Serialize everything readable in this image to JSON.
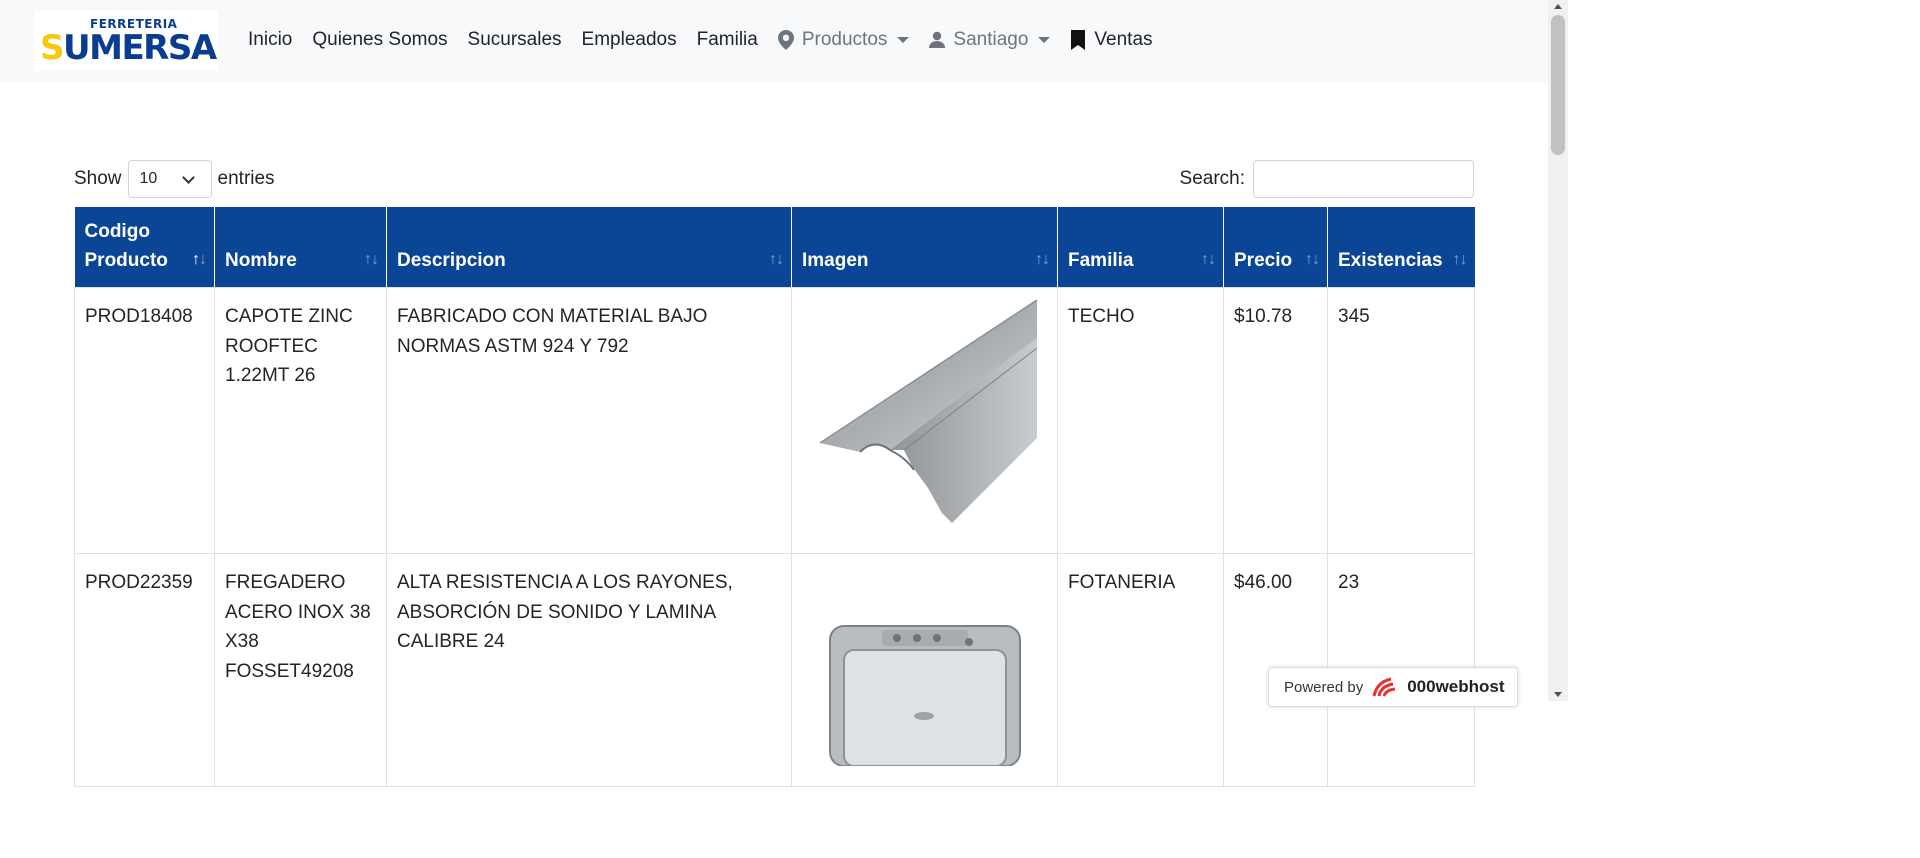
{
  "navbar": {
    "logo_top": "FERRETERIA",
    "logo_main": "SUMERSA",
    "items": [
      {
        "label": "Inicio"
      },
      {
        "label": "Quienes Somos"
      },
      {
        "label": "Sucursales"
      },
      {
        "label": "Empleados"
      },
      {
        "label": "Familia"
      },
      {
        "label": "Productos",
        "icon": "map-marker-icon"
      },
      {
        "label": "Santiago",
        "icon": "user-icon"
      },
      {
        "label": "Ventas",
        "icon": "bookmark-icon"
      }
    ]
  },
  "controls": {
    "show_label": "Show",
    "page_size": "10",
    "entries_label": "entries",
    "search_label": "Search:",
    "search_value": ""
  },
  "table": {
    "columns": [
      "Codigo Producto",
      "Nombre",
      "Descripcion",
      "Imagen",
      "Familia",
      "Precio",
      "Existencias"
    ],
    "rows": [
      {
        "codigo": "PROD18408",
        "nombre": "CAPOTE ZINC ROOFTEC 1.22MT 26",
        "descripcion": "FABRICADO CON MATERIAL BAJO NORMAS ASTM 924 Y 792",
        "familia": "TECHO",
        "precio": "$10.78",
        "existencias": "345"
      },
      {
        "codigo": "PROD22359",
        "nombre": "FREGADERO ACERO INOX 38 X38 FOSSET49208",
        "descripcion": "ALTA RESISTENCIA A LOS RAYONES, ABSORCIÓN DE SONIDO Y LAMINA CALIBRE 24",
        "familia": "FOTANERIA",
        "precio": "$46.00",
        "existencias": "23"
      }
    ]
  },
  "footer": {
    "powered_label": "Powered by",
    "powered_brand": "000webhost"
  }
}
